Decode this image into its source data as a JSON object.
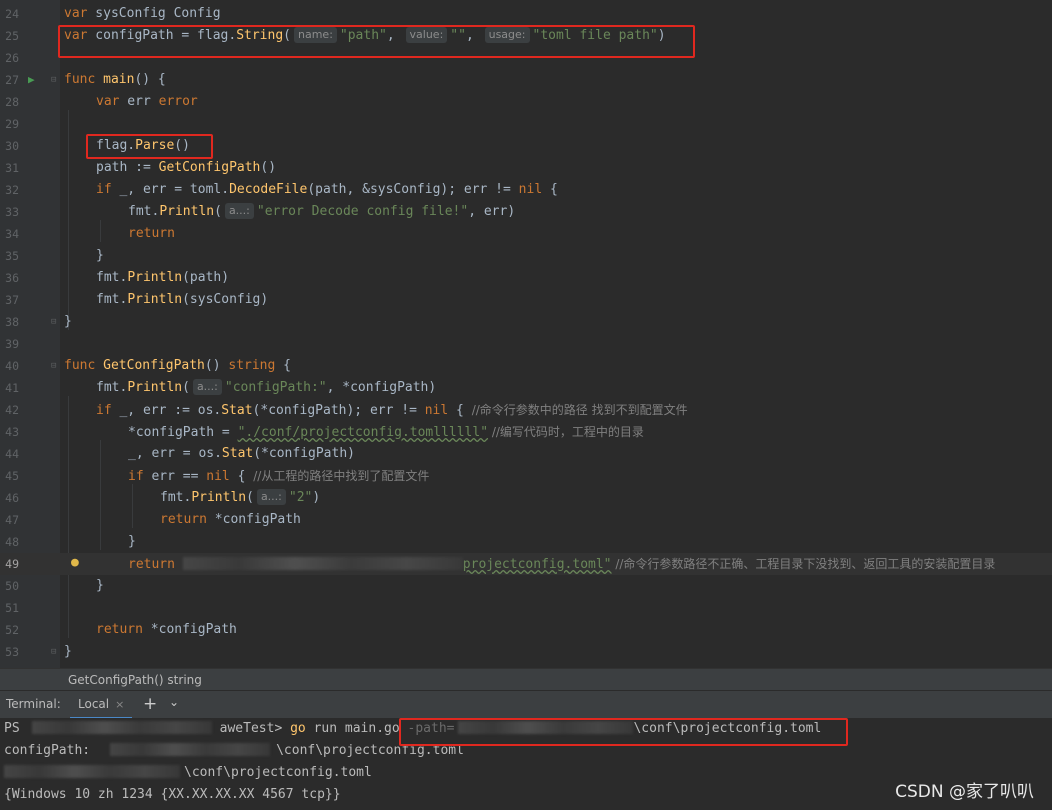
{
  "editor": {
    "lines": {
      "24": {
        "num": "24",
        "a": "var",
        "b": " sysConfig ",
        "c": "Config"
      },
      "25": {
        "num": "25",
        "a": "var",
        "b": " configPath = flag.",
        "c": "String",
        "d": "(",
        "h1": "name:",
        "s1": "\"path\"",
        "comma1": ", ",
        "h2": "value:",
        "s2": "\"\"",
        "comma2": ", ",
        "h3": "usage:",
        "s3": "\"toml file path\"",
        "e": ")"
      },
      "26": {
        "num": "26"
      },
      "27": {
        "num": "27",
        "a": "func",
        "b": " ",
        "c": "main",
        "d": "() {"
      },
      "28": {
        "num": "28",
        "a": "var",
        "b": " err ",
        "c": "error"
      },
      "29": {
        "num": "29"
      },
      "30": {
        "num": "30",
        "a": "flag.",
        "b": "Parse",
        "c": "()"
      },
      "31": {
        "num": "31",
        "a": "path := ",
        "b": "GetConfigPath",
        "c": "()"
      },
      "32": {
        "num": "32",
        "a": "if",
        "b": " _, err = toml.",
        "c": "DecodeFile",
        "d": "(path, &sysConfig); err != ",
        "e": "nil",
        "f": " {"
      },
      "33": {
        "num": "33",
        "a": "fmt.",
        "b": "Println",
        "c": "(",
        "h": "a...:",
        "s": "\"error Decode config file!\"",
        "d": ", err)"
      },
      "34": {
        "num": "34",
        "a": "return"
      },
      "35": {
        "num": "35",
        "a": "}"
      },
      "36": {
        "num": "36",
        "a": "fmt.",
        "b": "Println",
        "c": "(path)"
      },
      "37": {
        "num": "37",
        "a": "fmt.",
        "b": "Println",
        "c": "(sysConfig)"
      },
      "38": {
        "num": "38",
        "a": "}"
      },
      "39": {
        "num": "39"
      },
      "40": {
        "num": "40",
        "a": "func",
        "b": " ",
        "c": "GetConfigPath",
        "d": "() ",
        "e": "string",
        "f": " {"
      },
      "41": {
        "num": "41",
        "a": "fmt.",
        "b": "Println",
        "c": "(",
        "h": "a...:",
        "s": "\"configPath:\"",
        "d": ", *configPath)"
      },
      "42": {
        "num": "42",
        "a": "if",
        "b": " _, err := os.",
        "c": "Stat",
        "d": "(*configPath); err != ",
        "e": "nil",
        "f": " { ",
        "g": "//命令行参数中的路径 找到不到配置文件"
      },
      "43": {
        "num": "43",
        "a": "*configPath = ",
        "s": "\"./conf/projectconfig.tomllllll\"",
        "g": " //编写代码时，工程中的目录"
      },
      "44": {
        "num": "44",
        "a": "_, err = os.",
        "b": "Stat",
        "c": "(*configPath)"
      },
      "45": {
        "num": "45",
        "a": "if",
        "b": " err == ",
        "c": "nil",
        "d": " { ",
        "g": "//从工程的路径中找到了配置文件"
      },
      "46": {
        "num": "46",
        "a": "fmt.",
        "b": "Println",
        "c": "(",
        "h": "a...:",
        "s": "\"2\"",
        "d": ")"
      },
      "47": {
        "num": "47",
        "a": "return",
        "b": " *configPath"
      },
      "48": {
        "num": "48",
        "a": "}"
      },
      "49": {
        "num": "49",
        "a": "return",
        "s": "projectconfig.toml\"",
        "g": " //命令行参数路径不正确、工程目录下没找到、返回工具的安装配置目录"
      },
      "50": {
        "num": "50",
        "a": "}"
      },
      "51": {
        "num": "51"
      },
      "52": {
        "num": "52",
        "a": "return",
        "b": " *configPath"
      },
      "53": {
        "num": "53",
        "a": "}"
      }
    }
  },
  "breadcrumb": "GetConfigPath() string",
  "terminal": {
    "label": "Terminal:",
    "tab": "Local",
    "tab_close": "×",
    "plus": "+",
    "chevron": "⌄",
    "line1_prefix": "PS",
    "line1_mid": "aweTest>",
    "line1_cmd": "go",
    "line1_rest": " run main.go ",
    "line1_flag": "-path=",
    "line1_path": "\\conf\\projectconfig.toml",
    "line2_a": "configPath:",
    "line2_b": "\\conf\\projectconfig.toml",
    "line3": "\\conf\\projectconfig.toml",
    "line4": "{Windows 10 zh 1234 {XX.XX.XX.XX 4567 tcp}}"
  },
  "watermark": "CSDN @家了叭叭",
  "colors": {
    "keyword": "#cc7832",
    "function": "#ffc66d",
    "string": "#6a8759",
    "highlight_box": "#e0281f"
  },
  "icons": [
    "run-icon",
    "fold-icon",
    "bulb-icon",
    "close-icon",
    "plus-icon",
    "chevron-down-icon"
  ]
}
